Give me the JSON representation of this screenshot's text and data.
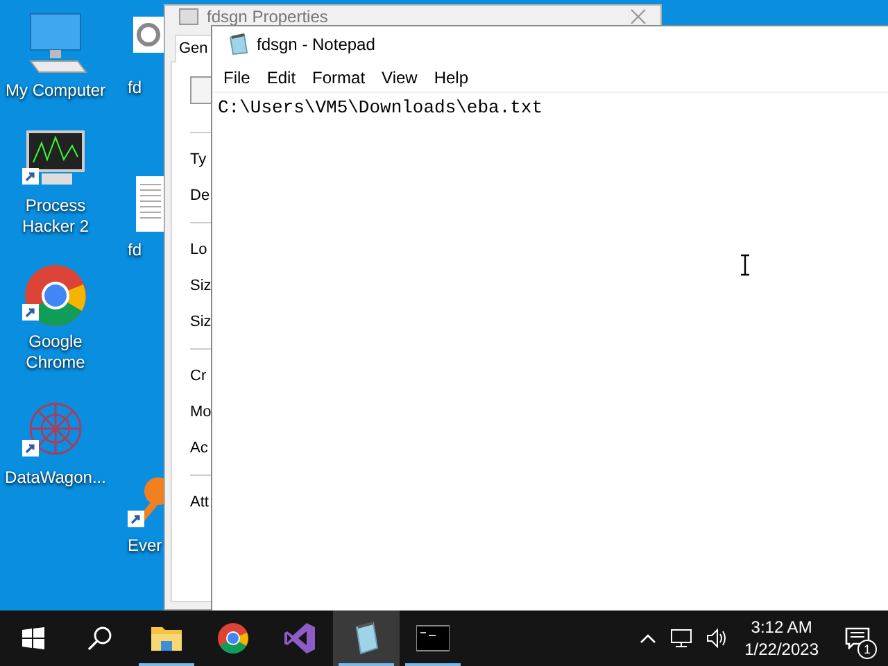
{
  "desktop_icons": [
    {
      "kind": "computer",
      "label": "My Computer"
    },
    {
      "kind": "hacker",
      "label": "Process Hacker 2"
    },
    {
      "kind": "chrome",
      "label": "Google Chrome"
    },
    {
      "kind": "wagon",
      "label": "DataWagon..."
    }
  ],
  "desktop_icons_2": [
    {
      "kind": "gear",
      "label": "fd"
    },
    {
      "kind": "document",
      "label": "fd"
    },
    {
      "kind": "everything",
      "label": "Ever"
    }
  ],
  "properties_window": {
    "title": "fdsgn Properties",
    "tab": "Gen",
    "rows": [
      {
        "kind": "icon"
      },
      {
        "kind": "rule"
      },
      {
        "kind": "label",
        "label": "Ty"
      },
      {
        "kind": "label",
        "label": "De"
      },
      {
        "kind": "rule"
      },
      {
        "kind": "label",
        "label": "Lo"
      },
      {
        "kind": "label",
        "label": "Siz"
      },
      {
        "kind": "label",
        "label": "Siz"
      },
      {
        "kind": "rule"
      },
      {
        "kind": "label",
        "label": "Cr"
      },
      {
        "kind": "label",
        "label": "Mo"
      },
      {
        "kind": "label",
        "label": "Ac"
      },
      {
        "kind": "rule"
      },
      {
        "kind": "label",
        "label": "Att"
      }
    ]
  },
  "notepad": {
    "title": "fdsgn - Notepad",
    "menu": [
      "File",
      "Edit",
      "Format",
      "View",
      "Help"
    ],
    "text": "C:\\Users\\VM5\\Downloads\\eba.txt"
  },
  "taskbar": {
    "apps": [
      {
        "kind": "explorer",
        "selected": false,
        "running": true
      },
      {
        "kind": "chrome",
        "selected": false,
        "running": false
      },
      {
        "kind": "vs",
        "selected": false,
        "running": false
      },
      {
        "kind": "notepad",
        "selected": true,
        "running": true
      },
      {
        "kind": "cmd",
        "selected": false,
        "running": true
      }
    ],
    "time": "3:12 AM",
    "date": "1/22/2023",
    "notifications": "1"
  }
}
